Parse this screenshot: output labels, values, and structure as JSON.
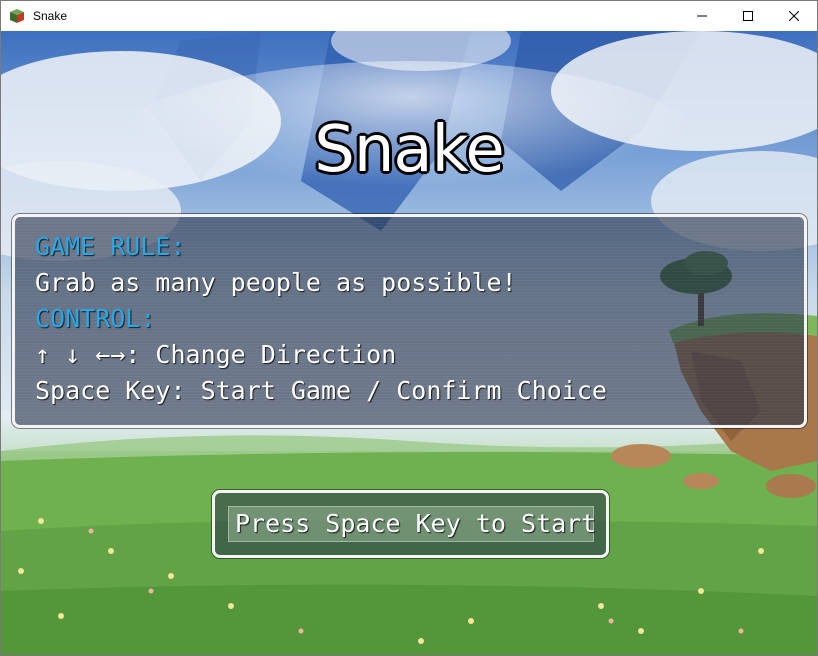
{
  "window": {
    "title": "Snake",
    "icons": {
      "app": "snake-app-icon",
      "minimize": "minimize-icon",
      "maximize": "maximize-icon",
      "close": "close-icon"
    }
  },
  "game": {
    "title": "Snake",
    "rules": {
      "heading_rule": "GAME RULE:",
      "rule_text": "Grab as many people as possible!",
      "heading_control": "CONTROL:",
      "control_direction": "↑ ↓ ←→: Change Direction",
      "control_space": "Space Key: Start Game / Confirm Choice"
    },
    "start_prompt": "Press Space Key to Start"
  },
  "colors": {
    "heading": "#28a8e8",
    "text": "#ffffff",
    "panel": "#28344b"
  }
}
